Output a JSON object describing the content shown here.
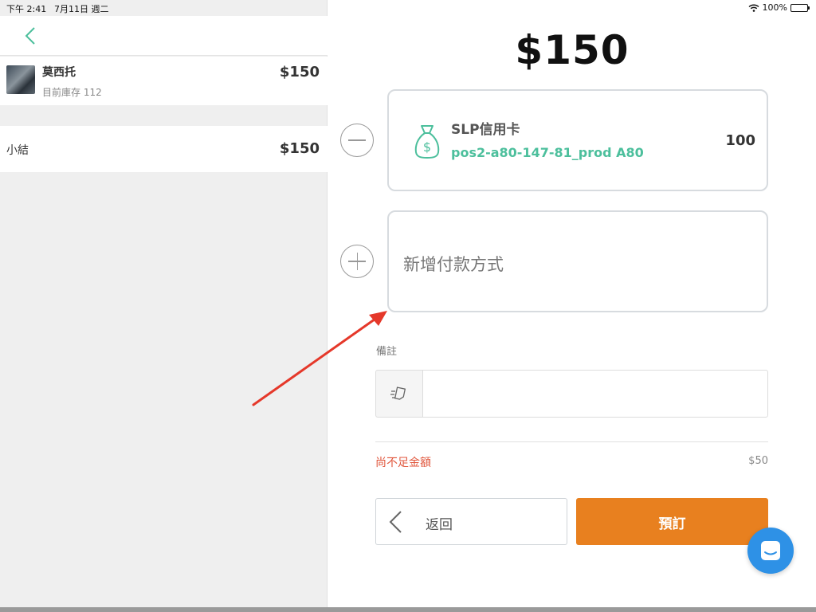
{
  "status_bar": {
    "time": "下午 2:41",
    "date": "7月11日 週二",
    "battery": "100%"
  },
  "cart": {
    "items": [
      {
        "name": "莫西托",
        "stock": "目前庫存 112",
        "price": "$150"
      }
    ],
    "subtotal": {
      "label": "小結",
      "value": "$150"
    }
  },
  "checkout": {
    "total": "$150",
    "payments": [
      {
        "name": "SLP信用卡",
        "device": "pos2-a80-147-81_prod A80",
        "amount": "100",
        "icon": "money-bag-icon"
      }
    ],
    "add_payment_label": "新增付款方式",
    "note_label": "備註",
    "note_value": "",
    "shortfall_label": "尚不足金額",
    "shortfall_value": "$50",
    "back_label": "返回",
    "reserve_label": "預訂"
  },
  "colors": {
    "accent_green": "#4cbf9c",
    "orange": "#e8801f",
    "warning_red": "#e0563c",
    "chat_blue": "#2e91e6",
    "annotation_red": "#e5382a"
  }
}
